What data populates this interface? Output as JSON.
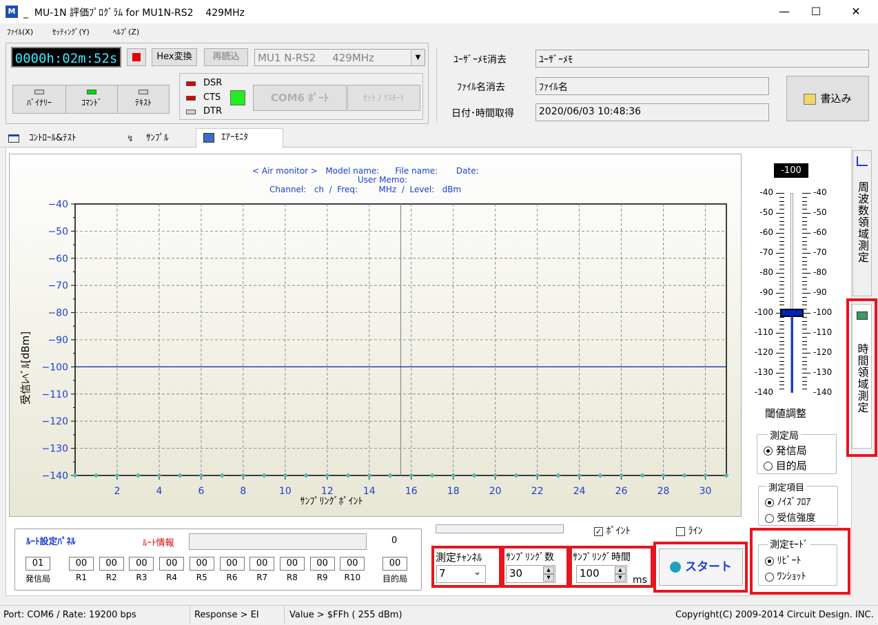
{
  "window": {
    "title": "_  MU-1N 評価ﾌﾟﾛｸﾞﾗﾑ for MU1N-RS2    429MHz",
    "icon": "app-icon"
  },
  "menu": [
    {
      "label": "ﾌｧｲﾙ(X)"
    },
    {
      "label": "ｾｯﾃｨﾝｸﾞ(Y)"
    },
    {
      "label": "ﾍﾙﾌﾟ(Z)"
    }
  ],
  "toolbar": {
    "timer": "0000h:02m:52s",
    "hex": "Hex変換",
    "reload": "再読込",
    "device": "MU1 N-RS2     429MHz",
    "modes": [
      {
        "label": "ﾊﾞｲﾅﾘｰ"
      },
      {
        "label": "ｺﾏﾝﾄﾞ"
      },
      {
        "label": "ﾃｷｽﾄ"
      }
    ],
    "signals": [
      "DSR",
      "CTS",
      "DTR"
    ],
    "port_btn": "COM6 ﾎﾟｰﾄ",
    "reset_btn": "ｾｯﾄ / ﾘｽﾀｰﾄ"
  },
  "info": {
    "memo_btn": "ﾕｰｻﾞｰﾒﾓ消去",
    "memo_val": "ﾕｰｻﾞｰﾒﾓ",
    "file_btn": "ﾌｧｲﾙ名消去",
    "file_val": "ﾌｧｲﾙ名",
    "date_btn": "日付･時間取得",
    "date_val": "2020/06/03 10:48:36",
    "write_btn": "書込み"
  },
  "tabs": [
    {
      "label": "ｺﾝﾄﾛｰﾙ&ﾃｽﾄ"
    },
    {
      "label": "ｻﾝﾌﾟﾙ"
    },
    {
      "label": "ｴｱｰﾓﾆﾀ"
    }
  ],
  "chart_header": {
    "line1": "< Air monitor >   Model name:      File name:       Date:",
    "line2": "User Memo:",
    "line3": "Channel:   ch  /  Freq:        MHz  /  Level:   dBm"
  },
  "chart_data": {
    "type": "line",
    "title": "< Air monitor >",
    "xlabel": "ｻﾝﾌﾟﾘﾝｸﾞﾎﾟｲﾝﾄ",
    "ylabel": "受信ﾚﾍﾞﾙ[dBm]",
    "xlim": [
      0,
      31
    ],
    "ylim": [
      -140,
      -40
    ],
    "xticks": [
      2,
      4,
      6,
      8,
      10,
      12,
      14,
      16,
      18,
      20,
      22,
      24,
      26,
      28,
      30
    ],
    "yticks": [
      -40,
      -50,
      -60,
      -70,
      -80,
      -90,
      -100,
      -110,
      -120,
      -130,
      -140
    ],
    "threshold": -100,
    "cursor_x": 15.5,
    "series": [
      {
        "values": [
          -140,
          -140,
          -140,
          -140,
          -140,
          -140,
          -140,
          -140,
          -140,
          -140,
          -140,
          -140,
          -140,
          -140,
          -140,
          -140,
          -140,
          -140,
          -140,
          -140,
          -140,
          -140,
          -140,
          -140,
          -140,
          -140,
          -140,
          -140,
          -140,
          -140,
          -140,
          -140
        ]
      }
    ]
  },
  "threshold": {
    "value": "-100",
    "ticks": [
      "-40",
      "-50",
      "-60",
      "-70",
      "-80",
      "-90",
      "-100",
      "-110",
      "-120",
      "-130",
      "-140"
    ],
    "label": "閾値調整",
    "level": -100
  },
  "station": {
    "legend": "測定局",
    "opts": [
      "発信局",
      "目的局"
    ]
  },
  "item": {
    "legend": "測定項目",
    "opts": [
      "ﾉｲｽﾞﾌﾛｱ",
      "受信強度"
    ]
  },
  "mode": {
    "legend": "測定ﾓｰﾄﾞ",
    "opts": [
      "ﾘﾋﾟｰﾄ",
      "ﾜﾝｼｮｯﾄ"
    ]
  },
  "side_tabs": [
    {
      "label": "周波数領域測定"
    },
    {
      "label": "時間領域測定"
    }
  ],
  "route": {
    "title": "ﾙｰﾄ設定ﾊﾟﾈﾙ",
    "info": "ﾙｰﾄ情報",
    "count": "0",
    "src": "01",
    "src_label": "発信局",
    "dst": "00",
    "dst_label": "目的局",
    "relays": [
      {
        "v": "00",
        "l": "R1"
      },
      {
        "v": "00",
        "l": "R2"
      },
      {
        "v": "00",
        "l": "R3"
      },
      {
        "v": "00",
        "l": "R4"
      },
      {
        "v": "00",
        "l": "R5"
      },
      {
        "v": "00",
        "l": "R6"
      },
      {
        "v": "00",
        "l": "R7"
      },
      {
        "v": "00",
        "l": "R8"
      },
      {
        "v": "00",
        "l": "R9"
      },
      {
        "v": "00",
        "l": "R10"
      }
    ]
  },
  "controls": {
    "point": "ﾎﾟｲﾝﾄ",
    "line": "ﾗｲﾝ",
    "ch_label": "測定ﾁｬﾝﾈﾙ",
    "ch": "7",
    "count_label": "ｻﾝﾌﾟﾘﾝｸﾞ数",
    "count": "30",
    "time_label": "ｻﾝﾌﾟﾘﾝｸﾞ時間",
    "time": "100",
    "unit": "ms",
    "start": "スタート"
  },
  "status": {
    "port": "Port: COM6 / Rate: 19200 bps",
    "resp": "Response > EI",
    "val": "Value > $FFh ( 255 dBm)",
    "copy": "Copyright(C) 2009-2014 Circuit Design. INC."
  },
  "colors": {
    "accent": "#1a3fd0",
    "highlight": "#e8141e",
    "timer": "#40e8ff",
    "plot": "#0020c0"
  }
}
